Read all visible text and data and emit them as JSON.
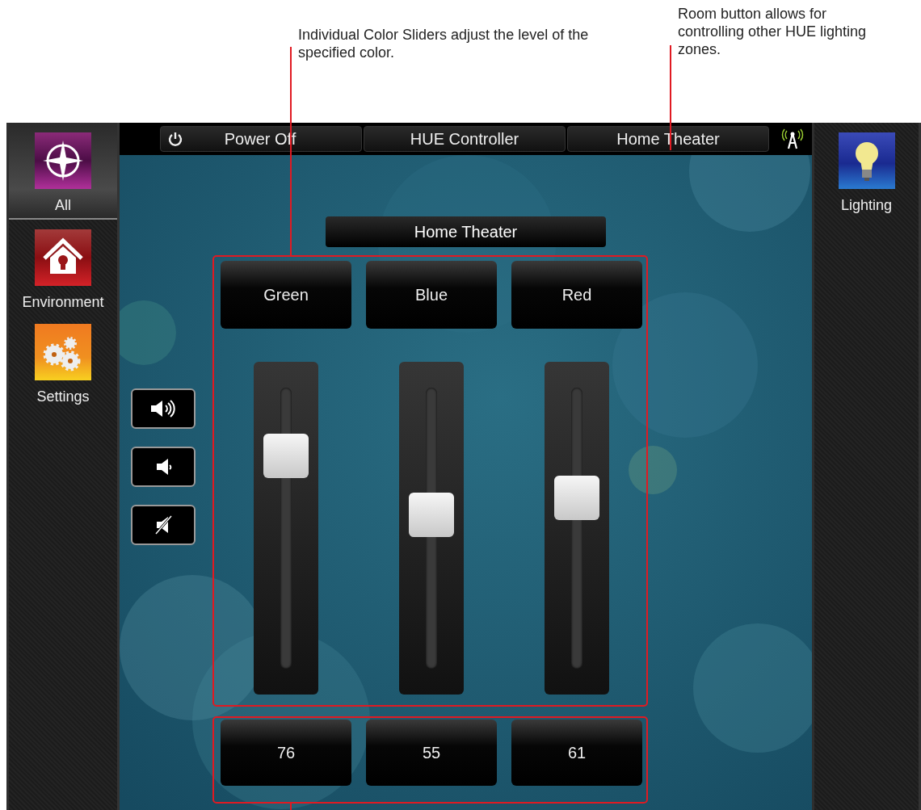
{
  "annotations": [
    {
      "kind": "sliders",
      "text": "Individual Color Sliders adjust the level of the specified color."
    },
    {
      "kind": "room",
      "text": "Room button allows for controlling other HUE lighting zones."
    }
  ],
  "left_sidebar": {
    "items": [
      {
        "kind": "all",
        "label": "All",
        "selected": true
      },
      {
        "kind": "environment",
        "label": "Environment",
        "selected": false
      },
      {
        "kind": "settings",
        "label": "Settings",
        "selected": false
      }
    ]
  },
  "top_bar": {
    "power_button": "Power Off",
    "title": "HUE Controller",
    "room_button": "Home Theater"
  },
  "room_label": "Home Theater",
  "volume_buttons": [
    {
      "kind": "up"
    },
    {
      "kind": "down"
    },
    {
      "kind": "mute"
    }
  ],
  "channels": [
    {
      "name": "Green",
      "level": 0.76,
      "value": "76"
    },
    {
      "name": "Blue",
      "level": 0.55,
      "value": "55"
    },
    {
      "name": "Red",
      "level": 0.61,
      "value": "61"
    }
  ],
  "right_sidebar": {
    "items": [
      {
        "kind": "lighting",
        "label": "Lighting",
        "selected": false
      }
    ]
  }
}
